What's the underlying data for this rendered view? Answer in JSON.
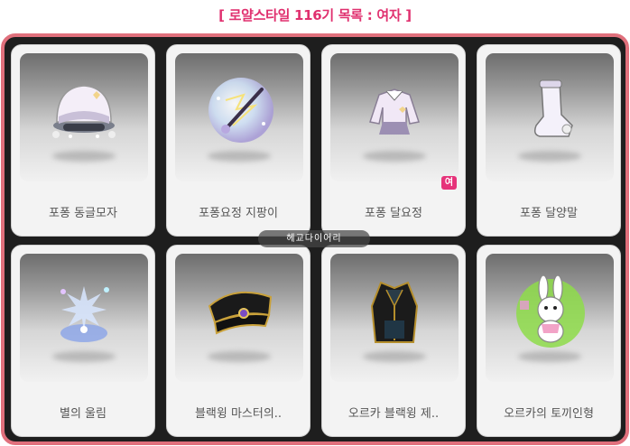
{
  "title": "[ 로얄스타일 116기 목록 : 여자 ]",
  "watermark": "헤교다이어리",
  "items": [
    {
      "name": "포퐁 동글모자",
      "icon": "round-hat-icon"
    },
    {
      "name": "포퐁요정 지팡이",
      "icon": "fairy-wand-icon"
    },
    {
      "name": "포퐁 달요정",
      "icon": "moon-fairy-outfit-icon",
      "badge": "여"
    },
    {
      "name": "포퐁 달양말",
      "icon": "moon-socks-icon"
    },
    {
      "name": "별의 울림",
      "icon": "star-echo-icon"
    },
    {
      "name": "블랙윙 마스터의..",
      "icon": "black-wing-cap-icon"
    },
    {
      "name": "오르카 블랙윙 제..",
      "icon": "black-wing-coat-icon"
    },
    {
      "name": "오르카의 토끼인형",
      "icon": "rabbit-doll-icon"
    }
  ],
  "colors": {
    "title": "#e0306f",
    "frame_border": "#e0707c",
    "badge": "#e6337a"
  }
}
